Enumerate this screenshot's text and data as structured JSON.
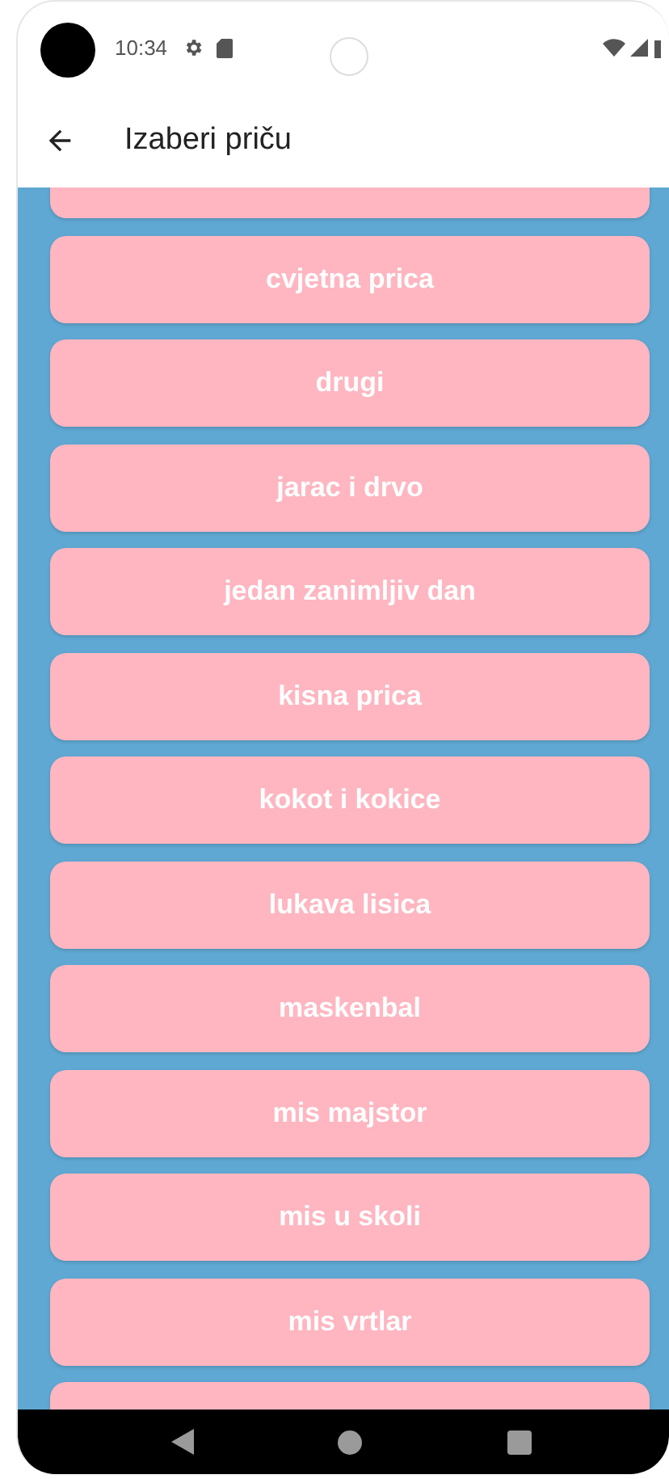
{
  "status_bar": {
    "time": "10:34"
  },
  "app_bar": {
    "title": "Izaberi priču"
  },
  "stories": [
    {
      "label": "cvjetna prica"
    },
    {
      "label": "drugi"
    },
    {
      "label": "jarac i drvo"
    },
    {
      "label": "jedan zanimljiv dan"
    },
    {
      "label": "kisna prica"
    },
    {
      "label": "kokot i kokice"
    },
    {
      "label": "lukava lisica"
    },
    {
      "label": "maskenbal"
    },
    {
      "label": "mis majstor"
    },
    {
      "label": "mis u skoli"
    },
    {
      "label": "mis vrtlar"
    }
  ]
}
